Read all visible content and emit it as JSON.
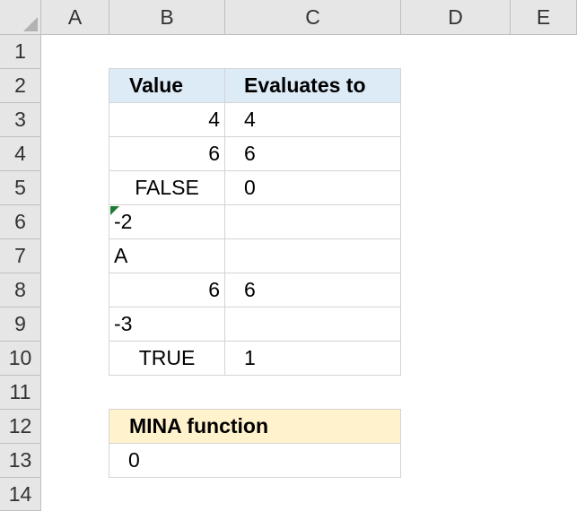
{
  "columns": [
    "A",
    "B",
    "C",
    "D",
    "E"
  ],
  "rows": [
    "1",
    "2",
    "3",
    "4",
    "5",
    "6",
    "7",
    "8",
    "9",
    "10",
    "11",
    "12",
    "13",
    "14"
  ],
  "table1": {
    "header": {
      "value": "Value",
      "evaluates": "Evaluates to"
    },
    "rows": [
      {
        "value": "4",
        "evaluates": "4"
      },
      {
        "value": "6",
        "evaluates": "6"
      },
      {
        "value": "FALSE",
        "evaluates": "0"
      },
      {
        "value": "-2",
        "evaluates": ""
      },
      {
        "value": "A",
        "evaluates": ""
      },
      {
        "value": "6",
        "evaluates": "6"
      },
      {
        "value": "-3",
        "evaluates": ""
      },
      {
        "value": "TRUE",
        "evaluates": "1"
      }
    ]
  },
  "table2": {
    "header": "MINA function",
    "result": "0"
  },
  "colors": {
    "header_blue": "#ddebf7",
    "header_yellow": "#fff2cc",
    "error_indicator": "#1e7b34"
  }
}
